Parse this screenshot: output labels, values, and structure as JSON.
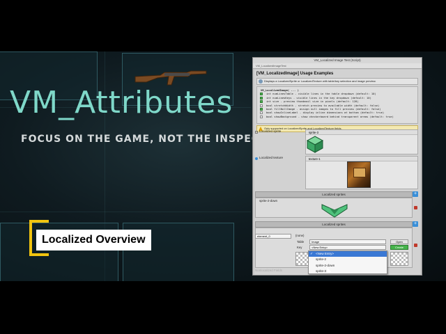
{
  "hero": {
    "title": "VM_Attributes",
    "subtitle": "FOCUS ON THE GAME, NOT THE INSPECTOR",
    "badge": "Localized Overview"
  },
  "window": {
    "title": "VM_Localized Image Test (Script)",
    "subtitle": "VM_LocalizedImageTest"
  },
  "section": {
    "title": "[VM_LocalizedImage] Usage Examples",
    "description": "Displays a LocalizedSprite or LocalizedTexture with table/key selection and image preview."
  },
  "code": {
    "header": "VM_LocalizedImage( ... )",
    "lines": [
      {
        "text": "int numLinesTable - visible lines in the table dropdown (default: 10)",
        "checked": true
      },
      {
        "text": "int numLinesKeys - visible lines in the key dropdown (default: 10)",
        "checked": true
      },
      {
        "text": "int size - preview thumbnail size in pixels (default: 128)",
        "checked": true
      },
      {
        "text": "bool stretchWidth - stretch preview to available width (default: false)",
        "checked": false
      },
      {
        "text": "bool fillNullImage - assign null images to fill preview (default: false)",
        "checked": true
      },
      {
        "text": "bool showInlineLabel - display inline dimensions at bottom (default: true)",
        "checked": false
      },
      {
        "text": "bool showBackground - show checkerboard behind transparent areas (default: true)",
        "checked": false
      }
    ]
  },
  "warning": "Only supported on LocalizedSprite and LocalizedTexture fields.",
  "fields": {
    "sprite_label": "Localized sprite",
    "sprite_value": "sprite-3",
    "texture_label": "Localized texture",
    "texture_value": "texture-1"
  },
  "list1": {
    "header": "Localized sprites",
    "item": "sprite-2-down"
  },
  "list2": {
    "header": "Localized sprites",
    "element_name": "element_0",
    "item_header": "(none)",
    "table_label": "Table",
    "table_value": "Image",
    "key_label": "Key",
    "key_value": "<New Entry>",
    "open_button": "Open",
    "create_button": "Create"
  },
  "dropdown": {
    "options": [
      "<New Entry>",
      "sprite-2",
      "sprite-2-down",
      "sprite-3"
    ],
    "selected_index": 0
  },
  "bottom_label": "Nonlocalized Fields",
  "colors": {
    "title_teal": "#7fd8c9",
    "badge_yellow": "#f1c40f",
    "accent_blue": "#3a8fd8",
    "create_green": "#45b34a"
  }
}
